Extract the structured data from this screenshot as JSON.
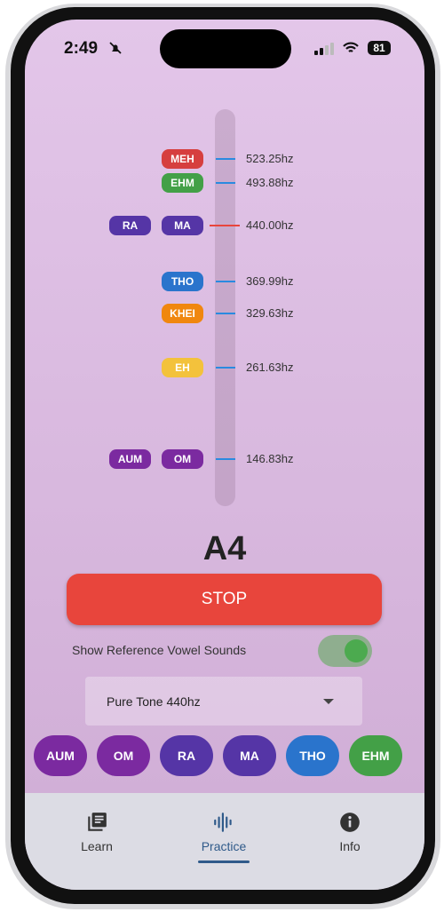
{
  "status_bar": {
    "time": "2:49",
    "battery": "81",
    "icons": [
      "bell-slash-icon",
      "signal-icon",
      "wifi-icon",
      "battery-icon"
    ]
  },
  "pitch_scale": {
    "markers": [
      {
        "labels": [
          "MEH"
        ],
        "freq": "523.25hz",
        "color": "#d63f3f",
        "active": false
      },
      {
        "labels": [
          "EHM"
        ],
        "freq": "493.88hz",
        "color": "#43a047",
        "active": false
      },
      {
        "labels": [
          "RA",
          "MA"
        ],
        "freq": "440.00hz",
        "color": "#5535a6",
        "active": true
      },
      {
        "labels": [
          "THO"
        ],
        "freq": "369.99hz",
        "color": "#2a74cc",
        "active": false
      },
      {
        "labels": [
          "KHEI"
        ],
        "freq": "329.63hz",
        "color": "#f0870f",
        "active": false
      },
      {
        "labels": [
          "EH"
        ],
        "freq": "261.63hz",
        "color": "#f3c23c",
        "active": false
      },
      {
        "labels": [
          "AUM",
          "OM"
        ],
        "freq": "146.83hz",
        "color": "#7b2aa0",
        "active": false
      }
    ]
  },
  "note": "A4",
  "stop_label": "STOP",
  "reference_toggle": {
    "label": "Show Reference Vowel Sounds",
    "on": true
  },
  "tone_select": {
    "value": "Pure Tone 440hz"
  },
  "chips": [
    {
      "label": "AUM",
      "color": "#7b2aa0"
    },
    {
      "label": "OM",
      "color": "#7b2aa0"
    },
    {
      "label": "RA",
      "color": "#5535a6"
    },
    {
      "label": "MA",
      "color": "#5535a6"
    },
    {
      "label": "THO",
      "color": "#2a74cc"
    },
    {
      "label": "EHM",
      "color": "#43a047"
    }
  ],
  "nav": {
    "items": [
      {
        "label": "Learn",
        "icon": "library-books-icon"
      },
      {
        "label": "Practice",
        "icon": "waveform-icon",
        "active": true
      },
      {
        "label": "Info",
        "icon": "info-icon"
      }
    ]
  },
  "colors": {
    "accent": "#2f5a8a",
    "stop": "#e8453c",
    "toggle": "#4caa4f"
  }
}
